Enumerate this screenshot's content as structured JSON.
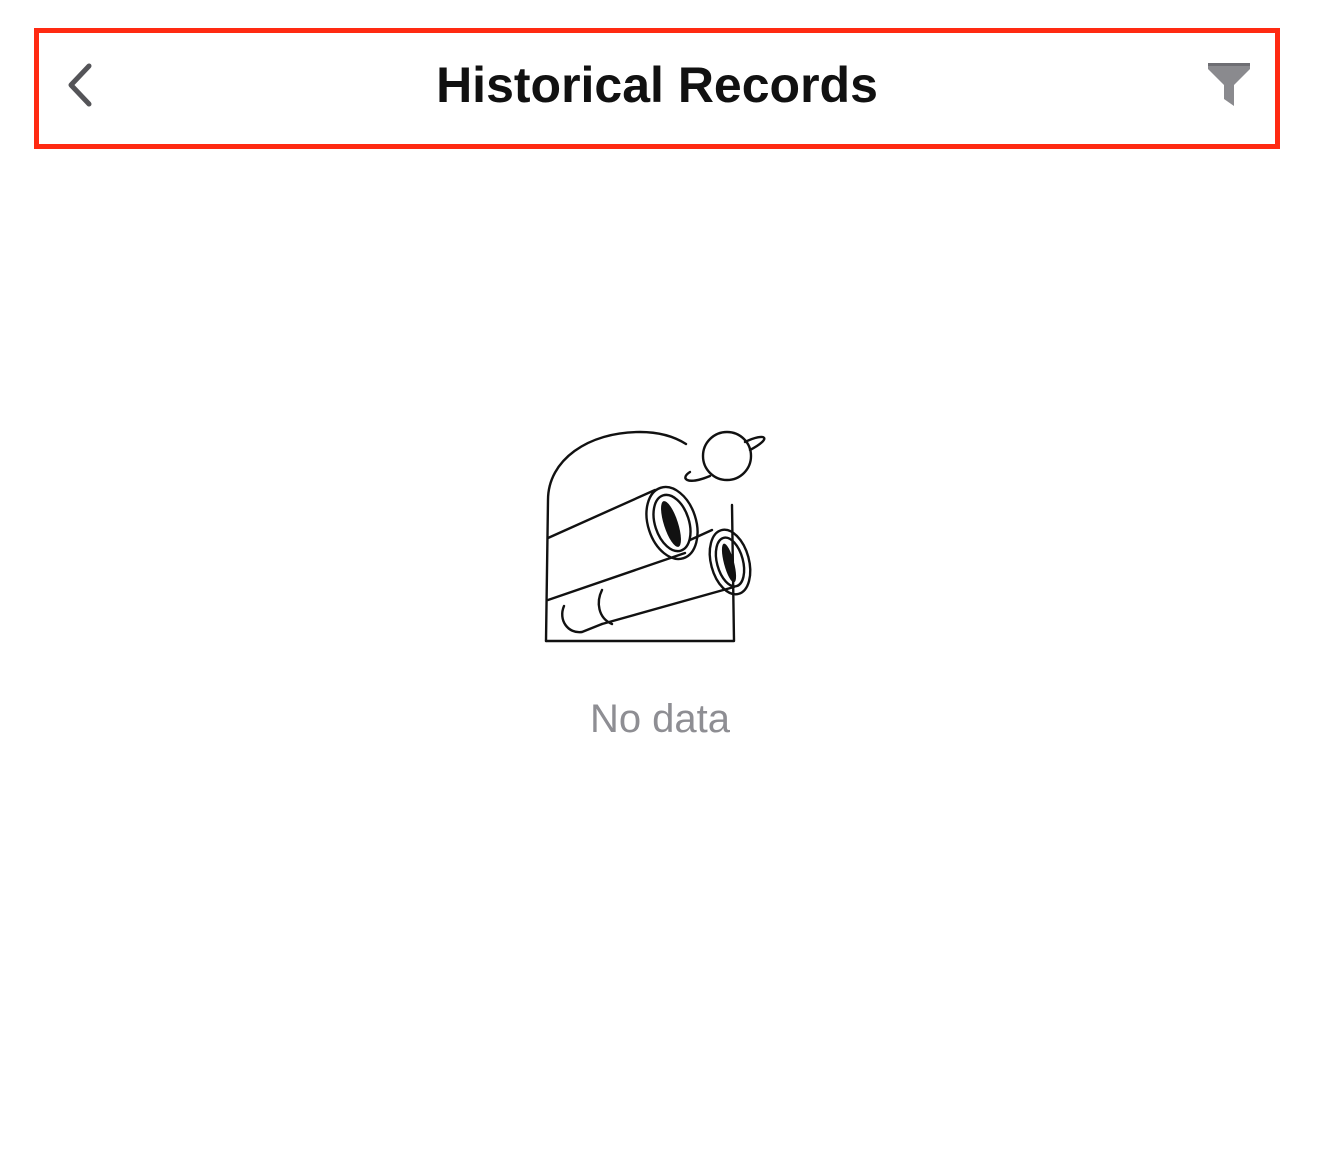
{
  "header": {
    "title": "Historical Records",
    "back_icon": "chevron-left-icon",
    "filter_icon": "filter-icon"
  },
  "empty_state": {
    "illustration_icon": "binoculars-planet-illustration",
    "message": "No data"
  },
  "colors": {
    "highlight": "#ff2a12",
    "title": "#111111",
    "icon": "#545458",
    "empty_text": "#8e8e93"
  }
}
